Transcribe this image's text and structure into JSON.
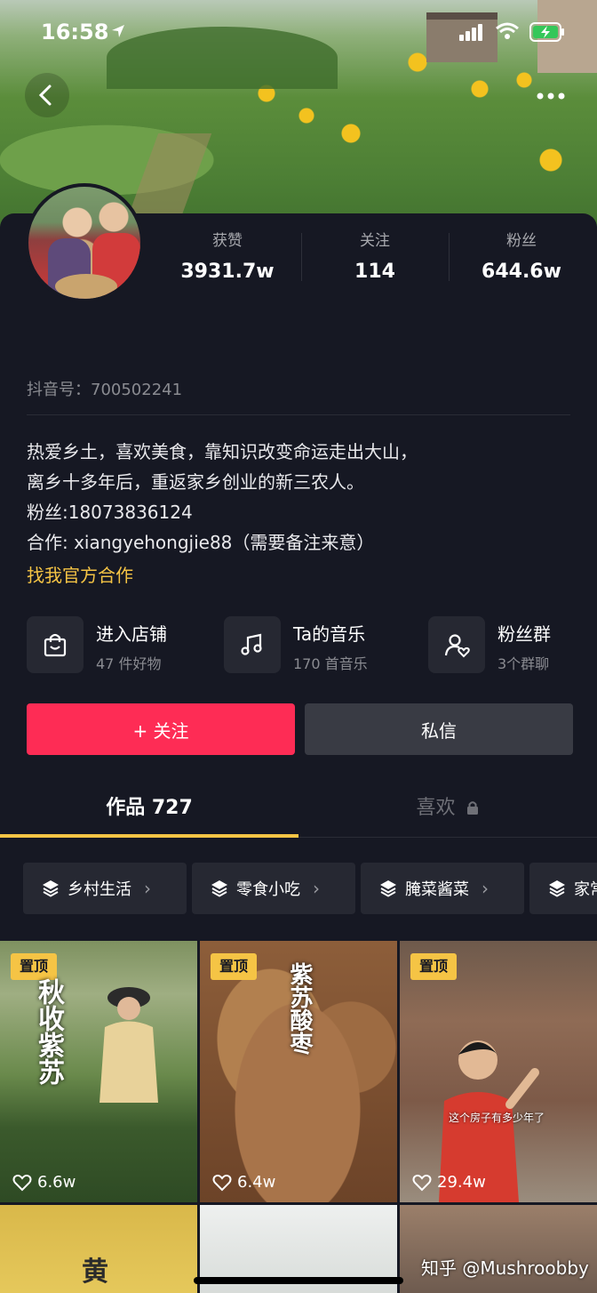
{
  "status_bar": {
    "time": "16:58"
  },
  "profile": {
    "stats": [
      {
        "label": "获赞",
        "value": "3931.7w"
      },
      {
        "label": "关注",
        "value": "114"
      },
      {
        "label": "粉丝",
        "value": "644.6w"
      }
    ],
    "douyin_id": "抖音号：700502241",
    "bio_lines": [
      "热爱乡土，喜欢美食，靠知识改变命运走出大山，",
      "离乡十多年后，重返家乡创业的新三农人。",
      "粉丝:18073836124",
      "合作: xiangyehongjie88（需要备注来意）"
    ],
    "cooperation_link": "找我官方合作"
  },
  "entries": [
    {
      "title": "进入店铺",
      "subtitle": "47 件好物",
      "icon": "bag-icon"
    },
    {
      "title": "Ta的音乐",
      "subtitle": "170 首音乐",
      "icon": "music-note-icon"
    },
    {
      "title": "粉丝群",
      "subtitle": "3个群聊",
      "icon": "group-icon"
    }
  ],
  "actions": {
    "follow": "+ 关注",
    "message": "私信"
  },
  "tabs": {
    "works": "作品 727",
    "likes": "喜欢"
  },
  "collections": [
    "乡村生活",
    "零食小吃",
    "腌菜酱菜",
    "家常"
  ],
  "videos": [
    {
      "badge": "置顶",
      "title": "秋收紫苏",
      "likes": "6.6w"
    },
    {
      "badge": "置顶",
      "title": "紫苏酸枣",
      "likes": "6.4w"
    },
    {
      "badge": "置顶",
      "caption": "这个房子有多少年了",
      "likes": "29.4w"
    }
  ],
  "row2": {
    "title_fragment": "黄"
  },
  "watermark": "知乎 @Mushroobby",
  "colors": {
    "accent_red": "#fe2c55",
    "accent_yellow": "#f5c445",
    "background": "#161823"
  }
}
